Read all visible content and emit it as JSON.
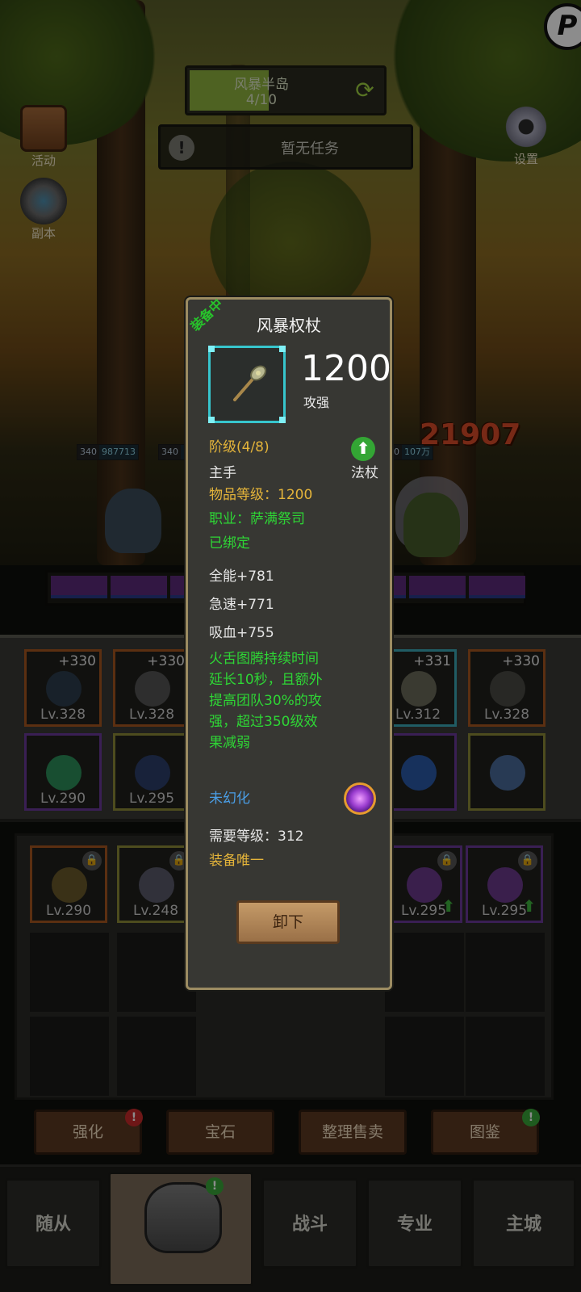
{
  "scene": {
    "zone_name": "风暴半岛",
    "zone_progress": "4/10",
    "zone_progress_fraction": 0.4,
    "task_text": "暂无任务",
    "activity_label": "活动",
    "dungeon_label": "副本",
    "settings_label": "设置",
    "ally_hp_1": {
      "level": "340",
      "value": "987713"
    },
    "ally_hp_2": {
      "level": "340",
      "value": ""
    },
    "enemy_hp": {
      "level": "340",
      "value": "107万"
    },
    "damage_number": "21907"
  },
  "equipment_slots": [
    {
      "plus": "+330",
      "level": "Lv.328",
      "rarity": "orange"
    },
    {
      "plus": "+330",
      "level": "Lv.328",
      "rarity": "orange"
    },
    {
      "plus": "+331",
      "level": "Lv.312",
      "rarity": "cyan"
    },
    {
      "plus": "+330",
      "level": "Lv.328",
      "rarity": "orange"
    },
    {
      "plus": "",
      "level": "Lv.290",
      "rarity": "purple"
    },
    {
      "plus": "",
      "level": "Lv.295",
      "rarity": "yellow"
    },
    {
      "plus": "",
      "level": "",
      "rarity": "purple"
    },
    {
      "plus": "",
      "level": "",
      "rarity": "yellow"
    }
  ],
  "bag_items": [
    {
      "level": "Lv.290"
    },
    {
      "level": "Lv.248"
    },
    {
      "level": "Lv.295"
    },
    {
      "level": "Lv.295"
    }
  ],
  "function_buttons": [
    "强化",
    "宝石",
    "整理售卖",
    "图鉴"
  ],
  "nav": [
    "随从",
    "装备",
    "战斗",
    "专业",
    "主城"
  ],
  "tooltip": {
    "equipped_tag": "装备中",
    "item_name": "风暴权杖",
    "power_value": "1200",
    "power_label": "攻强",
    "tier": "阶级(4/8)",
    "hand": "主手",
    "weapon_type": "法杖",
    "item_level": "物品等级：1200",
    "class": "职业：萨满祭司",
    "bound": "已绑定",
    "stats": [
      "全能+781",
      "急速+771",
      "吸血+755"
    ],
    "effect_lines": [
      "火舌图腾持续时间",
      "延长10秒，且额外",
      "提高团队30%的攻",
      "强，超过350级效",
      "果减弱"
    ],
    "transmog": "未幻化",
    "required_level": "需要等级：312",
    "unique": "装备唯一",
    "unequip_label": "卸下"
  },
  "colors": {
    "tier_yellow": "#e4b43a",
    "green_text": "#2ed635",
    "blue_text": "#4a9ee6",
    "frame_cyan": "#37c5cd"
  }
}
